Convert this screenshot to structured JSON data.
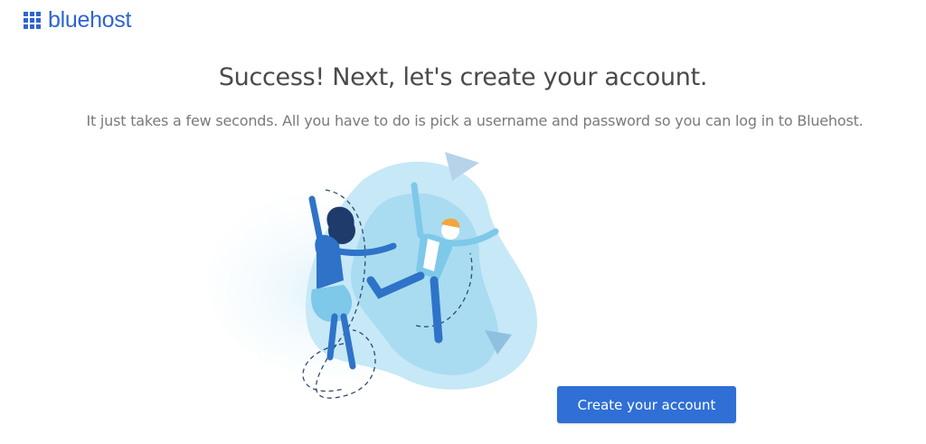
{
  "brand": {
    "name": "bluehost",
    "color": "#2f64d2"
  },
  "page": {
    "title": "Success! Next, let's create your account.",
    "subtitle": "It just takes a few seconds. All you have to do is pick a username and password so you can log in to Bluehost."
  },
  "illustration": {
    "icon": "celebrating-people-illustration"
  },
  "actions": {
    "create_account_label": "Create your account",
    "button_color": "#2f6fd6"
  }
}
